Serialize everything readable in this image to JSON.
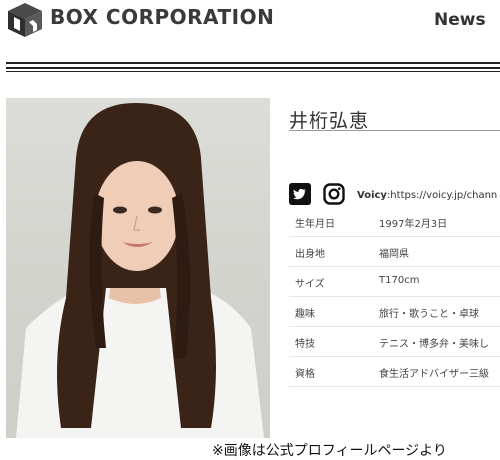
{
  "header": {
    "brand": "BOX CORPORATION",
    "nav_news": "News"
  },
  "profile": {
    "name": "井桁弘恵",
    "voicy_label": "Voicy",
    "voicy_url": ":https://voicy.jp/chann",
    "rows": [
      {
        "key": "生年月日",
        "value": "1997年2月3日"
      },
      {
        "key": "出身地",
        "value": "福岡県"
      },
      {
        "key": "サイズ",
        "value": "T170cm"
      },
      {
        "key": "趣味",
        "value": "旅行・歌うこと・卓球"
      },
      {
        "key": "特技",
        "value": "テニス・博多弁・美味し"
      },
      {
        "key": "資格",
        "value": "食生活アドバイザー三級"
      }
    ]
  },
  "footer": {
    "credit": "※画像は公式プロフィールページより"
  },
  "icons": {
    "logo": "box-logo-icon",
    "twitter": "twitter-icon",
    "instagram": "instagram-icon"
  },
  "colors": {
    "brand_text": "#3a3a3a",
    "rule": "#222222"
  }
}
